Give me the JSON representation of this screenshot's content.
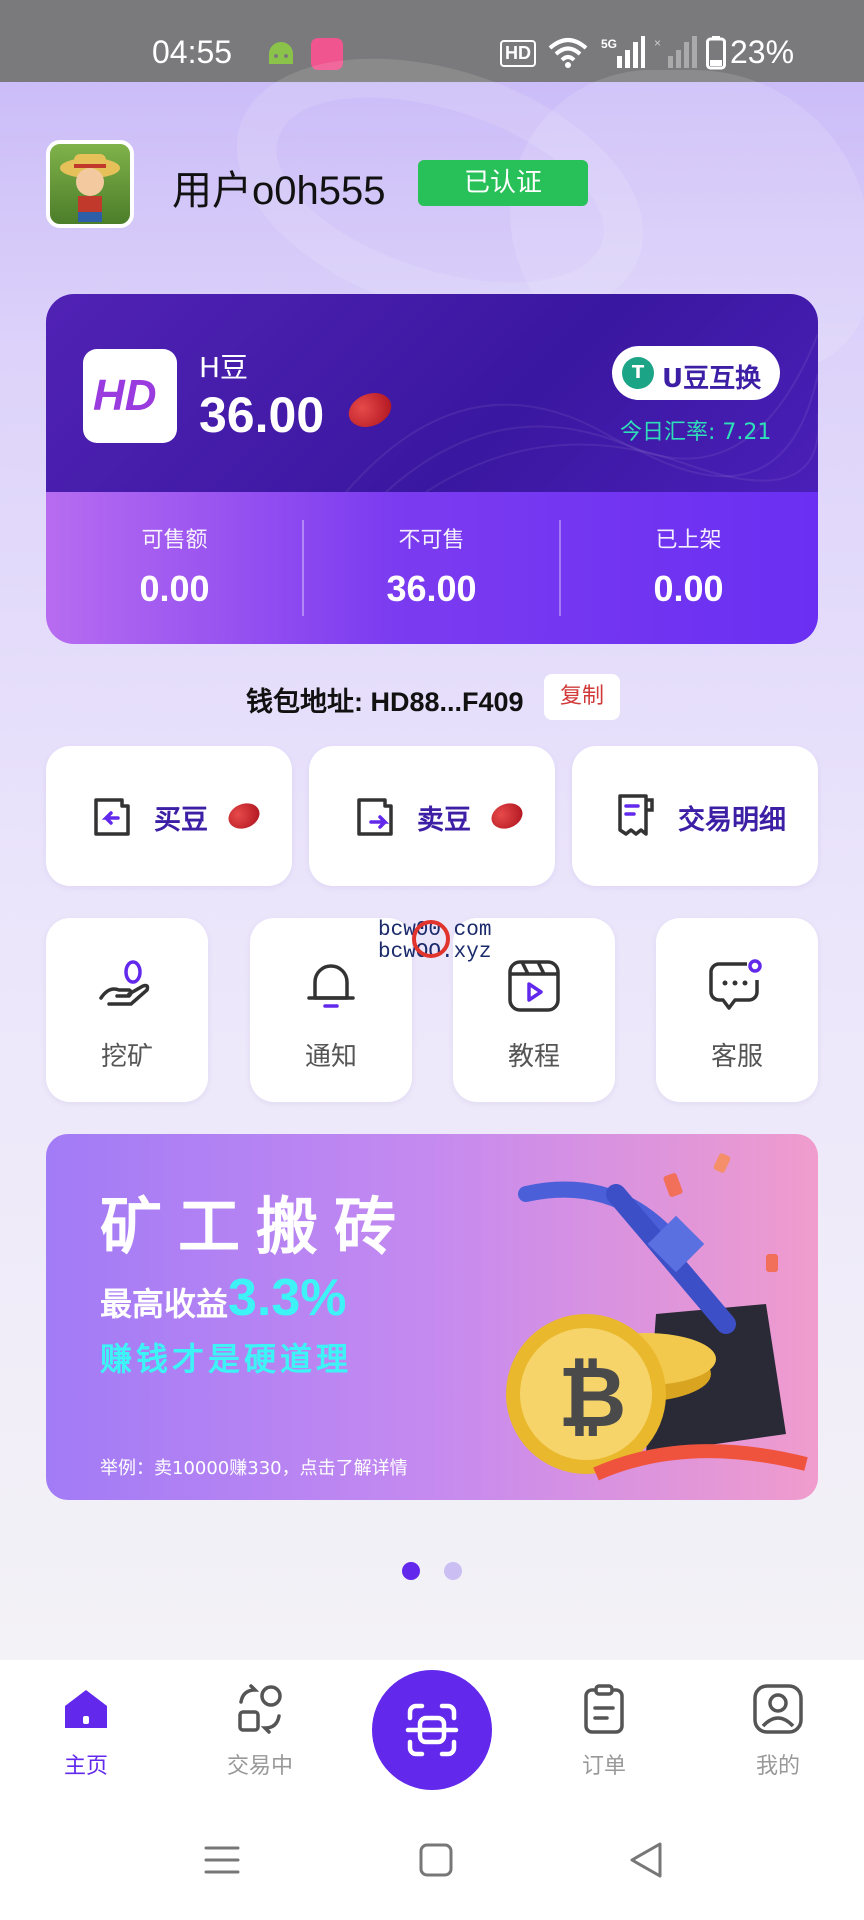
{
  "status_bar": {
    "time": "04:55",
    "hd_label": "HD",
    "network": "5G",
    "battery": "23%"
  },
  "user": {
    "name": "用户o0h555",
    "verified_label": "已认证"
  },
  "balance_card": {
    "coin_name": "H豆",
    "amount": "36.00",
    "swap_button": "U豆互换",
    "rate_text": "今日汇率: 7.21",
    "stats": [
      {
        "label": "可售额",
        "value": "0.00"
      },
      {
        "label": "不可售",
        "value": "36.00"
      },
      {
        "label": "已上架",
        "value": "0.00"
      }
    ]
  },
  "wallet": {
    "address_text": "钱包地址: HD88...F409",
    "copy_label": "复制"
  },
  "actions": {
    "buy": "买豆",
    "sell": "卖豆",
    "details": "交易明细"
  },
  "tools": [
    {
      "label": "挖矿",
      "icon": "mining-icon"
    },
    {
      "label": "通知",
      "icon": "bell-icon"
    },
    {
      "label": "教程",
      "icon": "video-tutorial-icon"
    },
    {
      "label": "客服",
      "icon": "chat-support-icon"
    }
  ],
  "watermark": {
    "line1": "bcw00.com",
    "line2": "bcwOO.xyz"
  },
  "banner": {
    "title": "矿工搬砖",
    "line2_prefix": "最高收益",
    "line2_highlight": "3.3%",
    "line3": "赚钱才是硬道理",
    "note": "举例：卖10000赚330，点击了解详情",
    "active_slide": 1,
    "slide_count": 2
  },
  "bottom_nav": {
    "home": "主页",
    "trading": "交易中",
    "orders": "订单",
    "mine": "我的"
  },
  "colors": {
    "primary": "#6228ec",
    "card_dark": "#3a17a0",
    "accent_green": "#28c058",
    "teal": "#2ee0b9"
  }
}
